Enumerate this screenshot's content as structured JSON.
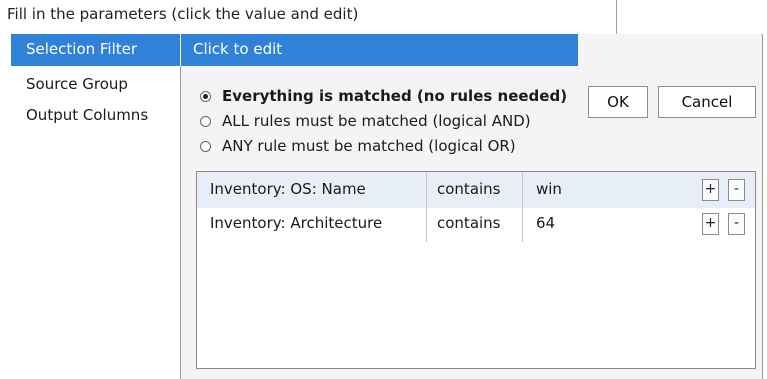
{
  "instruction": "Fill in the parameters (click the value and edit)",
  "header": {
    "left_label": "Selection Filter",
    "right_label": "Click to edit"
  },
  "sidebar": {
    "items": [
      {
        "label": "Source Group"
      },
      {
        "label": "Output Columns"
      }
    ]
  },
  "match_options": [
    {
      "label": "Everything is matched (no rules needed)",
      "selected": true
    },
    {
      "label": "ALL rules must be matched (logical AND)",
      "selected": false
    },
    {
      "label": "ANY rule must be matched (logical OR)",
      "selected": false
    }
  ],
  "buttons": {
    "ok": "OK",
    "cancel": "Cancel"
  },
  "rules": [
    {
      "field": "Inventory: OS: Name",
      "operator": "contains",
      "value": "win",
      "add": "+",
      "remove": "-"
    },
    {
      "field": "Inventory: Architecture",
      "operator": "contains",
      "value": "64",
      "add": "+",
      "remove": "-"
    }
  ]
}
